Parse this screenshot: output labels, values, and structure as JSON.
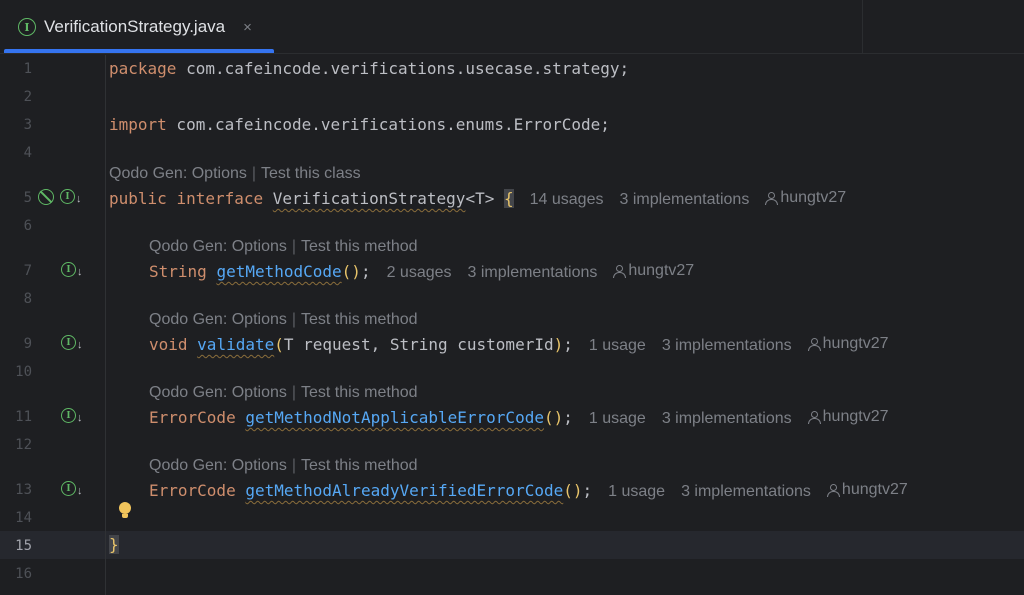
{
  "tab": {
    "icon": "interface-icon",
    "icon_glyph": "I",
    "title": "VerificationStrategy.java",
    "close_glyph": "×"
  },
  "colors": {
    "accent": "#3574f0",
    "keyword": "#cf8e6d",
    "method": "#56a8f5",
    "icon_green": "#5fb865",
    "hint": "#7d8087",
    "background": "#1e1f22"
  },
  "line_numbers": [
    "1",
    "2",
    "3",
    "4",
    "5",
    "6",
    "7",
    "8",
    "9",
    "10",
    "11",
    "12",
    "13",
    "14",
    "15",
    "16"
  ],
  "current_line": "15",
  "code": {
    "l1": {
      "kw": "package",
      "rest": " com.cafeincode.verifications.usecase.strategy;"
    },
    "l3": {
      "kw": "import",
      "rest": " com.cafeincode.verifications.enums.ErrorCode;"
    },
    "class_hint": {
      "options": "Qodo Gen: Options",
      "sep": "|",
      "test": "Test this class"
    },
    "l5": {
      "kw1": "public",
      "kw2": "interface",
      "name": "VerificationStrategy",
      "generic": "<T>",
      "brace": "{",
      "usages": "14 usages",
      "impls": "3 implementations",
      "author": "hungtv27"
    },
    "method_hint": {
      "options": "Qodo Gen: Options",
      "sep": "|",
      "test": "Test this method"
    },
    "l7": {
      "type": "String",
      "name": "getMethodCode",
      "parens": "()",
      "semi": ";",
      "usages": "2 usages",
      "impls": "3 implementations",
      "author": "hungtv27"
    },
    "l9": {
      "type": "void",
      "name": "validate",
      "open": "(",
      "params": "T request, String customerId",
      "close": ")",
      "semi": ";",
      "usages": "1 usage",
      "impls": "3 implementations",
      "author": "hungtv27"
    },
    "l11": {
      "type": "ErrorCode",
      "name": "getMethodNotApplicableErrorCode",
      "parens": "()",
      "semi": ";",
      "usages": "1 usage",
      "impls": "3 implementations",
      "author": "hungtv27"
    },
    "l13": {
      "type": "ErrorCode",
      "name": "getMethodAlreadyVerifiedErrorCode",
      "parens": "()",
      "semi": ";",
      "usages": "1 usage",
      "impls": "3 implementations",
      "author": "hungtv27"
    },
    "l15": {
      "brace": "}"
    }
  },
  "gutter_icons": {
    "l5": [
      "no-entry-icon",
      "implemented-interface-icon"
    ],
    "l7": [
      "implemented-interface-icon"
    ],
    "l9": [
      "implemented-interface-icon"
    ],
    "l11": [
      "implemented-interface-icon"
    ],
    "l13": [
      "implemented-interface-icon"
    ]
  },
  "intention_icon": "lightbulb-icon"
}
